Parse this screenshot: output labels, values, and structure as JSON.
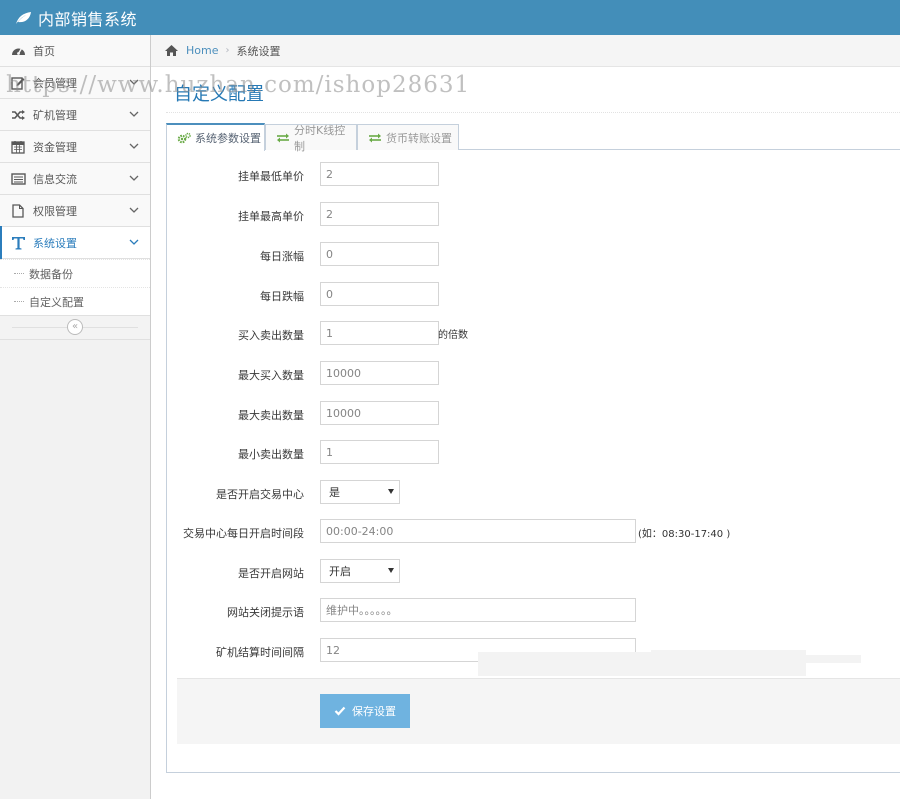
{
  "app": {
    "title": "内部销售系统"
  },
  "sidebar": {
    "items": [
      {
        "label": "首页",
        "icon": "dashboard-icon"
      },
      {
        "label": "会员管理",
        "icon": "edit-icon"
      },
      {
        "label": "矿机管理",
        "icon": "shuffle-icon"
      },
      {
        "label": "资金管理",
        "icon": "calendar-icon"
      },
      {
        "label": "信息交流",
        "icon": "list-alt-icon"
      },
      {
        "label": "权限管理",
        "icon": "file-icon"
      },
      {
        "label": "系统设置",
        "icon": "text-icon"
      }
    ],
    "submenu": [
      {
        "label": "数据备份"
      },
      {
        "label": "自定义配置"
      }
    ],
    "collapse_label": "«"
  },
  "breadcrumbs": {
    "home": "Home",
    "sep": "›",
    "current": "系统设置"
  },
  "page": {
    "title": "自定义配置"
  },
  "watermark": "https://www.huzhan.com/ishop28631",
  "tabs": [
    {
      "label": "系统参数设置",
      "icon": "cogs-icon",
      "active": true
    },
    {
      "label": "分时K线控制",
      "icon": "exchange-icon",
      "active": false
    },
    {
      "label": "货币转账设置",
      "icon": "exchange-icon",
      "active": false
    }
  ],
  "form": {
    "fields": [
      {
        "label": "挂单最低单价",
        "value": "2"
      },
      {
        "label": "挂单最高单价",
        "value": "2"
      },
      {
        "label": "每日涨幅",
        "value": "0"
      },
      {
        "label": "每日跌幅",
        "value": "0"
      },
      {
        "label": "买入卖出数量",
        "value": "1",
        "help": "的倍数"
      },
      {
        "label": "最大买入数量",
        "value": "10000"
      },
      {
        "label": "最大卖出数量",
        "value": "10000"
      },
      {
        "label": "最小卖出数量",
        "value": "1"
      },
      {
        "label": "是否开启交易中心",
        "value": "是"
      },
      {
        "label": "交易中心每日开启时间段",
        "value": "00:00-24:00",
        "help": "(如：08:30-17:40 )"
      },
      {
        "label": "是否开启网站",
        "value": "开启"
      },
      {
        "label": "网站关闭提示语",
        "value": "维护中。。。。。。"
      },
      {
        "label": "矿机结算时间间隔",
        "value": "12"
      }
    ]
  },
  "actions": {
    "save_label": "保存设置"
  },
  "colors": {
    "navbar": "#438eb9",
    "accent": "#2b7dbc",
    "save_button": "#6fb3e0"
  }
}
